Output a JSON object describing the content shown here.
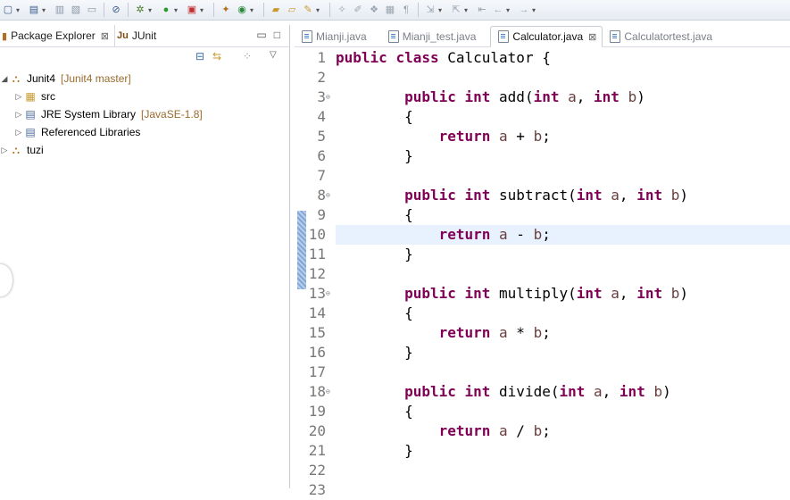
{
  "toolbar": {
    "icons": [
      "new-icon",
      "new-dropdown",
      "save-icon",
      "save-all-icon",
      "print-icon",
      "debug-icon",
      "run-icon",
      "coverage-icon",
      "new-project-icon",
      "open-type-icon",
      "search-icon",
      "next-annotation-icon",
      "prev-annotation-icon",
      "back-icon",
      "forward-icon"
    ]
  },
  "explorer": {
    "tabs": [
      {
        "label": "Package Explorer",
        "close": "⊠"
      },
      {
        "prefix": "Ju",
        "label": "JUnit"
      }
    ],
    "tree": [
      {
        "label": "Junit4",
        "decoration": "[Junit4 master]",
        "level": 0,
        "expanded": true,
        "icon": "project-icon"
      },
      {
        "label": "src",
        "level": 1,
        "expanded": false,
        "icon": "package-folder-icon"
      },
      {
        "label": "JRE System Library",
        "decoration": "[JavaSE-1.8]",
        "level": 1,
        "expanded": false,
        "icon": "library-icon"
      },
      {
        "label": "Referenced Libraries",
        "level": 1,
        "expanded": false,
        "icon": "library-icon"
      },
      {
        "label": "tuzi",
        "level": 0,
        "expanded": false,
        "icon": "project-icon"
      }
    ]
  },
  "editor": {
    "tabs": [
      {
        "label": "Mianji.java",
        "active": false
      },
      {
        "label": "Mianji_test.java",
        "active": false
      },
      {
        "label": "Calculator.java",
        "active": true,
        "close": "⊠"
      },
      {
        "label": "Calculatortest.java",
        "active": false
      }
    ],
    "current_line": 10,
    "lines": [
      {
        "n": "1",
        "tokens": [
          [
            "kw",
            "public"
          ],
          [
            "t",
            " "
          ],
          [
            "kw",
            "class"
          ],
          [
            "t",
            " Calculator {"
          ]
        ]
      },
      {
        "n": "2",
        "tokens": []
      },
      {
        "n": "3",
        "fold": true,
        "tokens": [
          [
            "t",
            "        "
          ],
          [
            "kw",
            "public"
          ],
          [
            "t",
            " "
          ],
          [
            "kw",
            "int"
          ],
          [
            "t",
            " add("
          ],
          [
            "kw",
            "int"
          ],
          [
            "t",
            " "
          ],
          [
            "v",
            "a"
          ],
          [
            "t",
            ", "
          ],
          [
            "kw",
            "int"
          ],
          [
            "t",
            " "
          ],
          [
            "v",
            "b"
          ],
          [
            "t",
            ")"
          ]
        ]
      },
      {
        "n": "4",
        "tokens": [
          [
            "t",
            "        {"
          ]
        ]
      },
      {
        "n": "5",
        "tokens": [
          [
            "t",
            "            "
          ],
          [
            "kw",
            "return"
          ],
          [
            "t",
            " "
          ],
          [
            "v",
            "a"
          ],
          [
            "t",
            " + "
          ],
          [
            "v",
            "b"
          ],
          [
            "t",
            ";"
          ]
        ]
      },
      {
        "n": "6",
        "tokens": [
          [
            "t",
            "        }"
          ]
        ]
      },
      {
        "n": "7",
        "tokens": []
      },
      {
        "n": "8",
        "fold": true,
        "tokens": [
          [
            "t",
            "        "
          ],
          [
            "kw",
            "public"
          ],
          [
            "t",
            " "
          ],
          [
            "kw",
            "int"
          ],
          [
            "t",
            " subtract("
          ],
          [
            "kw",
            "int"
          ],
          [
            "t",
            " "
          ],
          [
            "v",
            "a"
          ],
          [
            "t",
            ", "
          ],
          [
            "kw",
            "int"
          ],
          [
            "t",
            " "
          ],
          [
            "v",
            "b"
          ],
          [
            "t",
            ")"
          ]
        ]
      },
      {
        "n": "9",
        "tokens": [
          [
            "t",
            "        {"
          ]
        ]
      },
      {
        "n": "10",
        "tokens": [
          [
            "t",
            "            "
          ],
          [
            "kw",
            "return"
          ],
          [
            "t",
            " "
          ],
          [
            "v",
            "a"
          ],
          [
            "t",
            " - "
          ],
          [
            "v",
            "b"
          ],
          [
            "t",
            ";"
          ]
        ]
      },
      {
        "n": "11",
        "tokens": [
          [
            "t",
            "        }"
          ]
        ]
      },
      {
        "n": "12",
        "tokens": []
      },
      {
        "n": "13",
        "fold": true,
        "tokens": [
          [
            "t",
            "        "
          ],
          [
            "kw",
            "public"
          ],
          [
            "t",
            " "
          ],
          [
            "kw",
            "int"
          ],
          [
            "t",
            " multiply("
          ],
          [
            "kw",
            "int"
          ],
          [
            "t",
            " "
          ],
          [
            "v",
            "a"
          ],
          [
            "t",
            ", "
          ],
          [
            "kw",
            "int"
          ],
          [
            "t",
            " "
          ],
          [
            "v",
            "b"
          ],
          [
            "t",
            ")"
          ]
        ]
      },
      {
        "n": "14",
        "tokens": [
          [
            "t",
            "        {"
          ]
        ]
      },
      {
        "n": "15",
        "tokens": [
          [
            "t",
            "            "
          ],
          [
            "kw",
            "return"
          ],
          [
            "t",
            " "
          ],
          [
            "v",
            "a"
          ],
          [
            "t",
            " * "
          ],
          [
            "v",
            "b"
          ],
          [
            "t",
            ";"
          ]
        ]
      },
      {
        "n": "16",
        "tokens": [
          [
            "t",
            "        }"
          ]
        ]
      },
      {
        "n": "17",
        "tokens": []
      },
      {
        "n": "18",
        "fold": true,
        "tokens": [
          [
            "t",
            "        "
          ],
          [
            "kw",
            "public"
          ],
          [
            "t",
            " "
          ],
          [
            "kw",
            "int"
          ],
          [
            "t",
            " divide("
          ],
          [
            "kw",
            "int"
          ],
          [
            "t",
            " "
          ],
          [
            "v",
            "a"
          ],
          [
            "t",
            ", "
          ],
          [
            "kw",
            "int"
          ],
          [
            "t",
            " "
          ],
          [
            "v",
            "b"
          ],
          [
            "t",
            ")"
          ]
        ]
      },
      {
        "n": "19",
        "tokens": [
          [
            "t",
            "        {"
          ]
        ]
      },
      {
        "n": "20",
        "tokens": [
          [
            "t",
            "            "
          ],
          [
            "kw",
            "return"
          ],
          [
            "t",
            " "
          ],
          [
            "v",
            "a"
          ],
          [
            "t",
            " / "
          ],
          [
            "v",
            "b"
          ],
          [
            "t",
            ";"
          ]
        ]
      },
      {
        "n": "21",
        "tokens": [
          [
            "t",
            "        }"
          ]
        ]
      },
      {
        "n": "22",
        "tokens": []
      },
      {
        "n": "23",
        "tokens": []
      }
    ]
  },
  "colors": {
    "keyword": "#7f0055",
    "variable": "#6a3e3e",
    "line_number": "#787878",
    "current_line_bg": "#e8f2fe"
  }
}
